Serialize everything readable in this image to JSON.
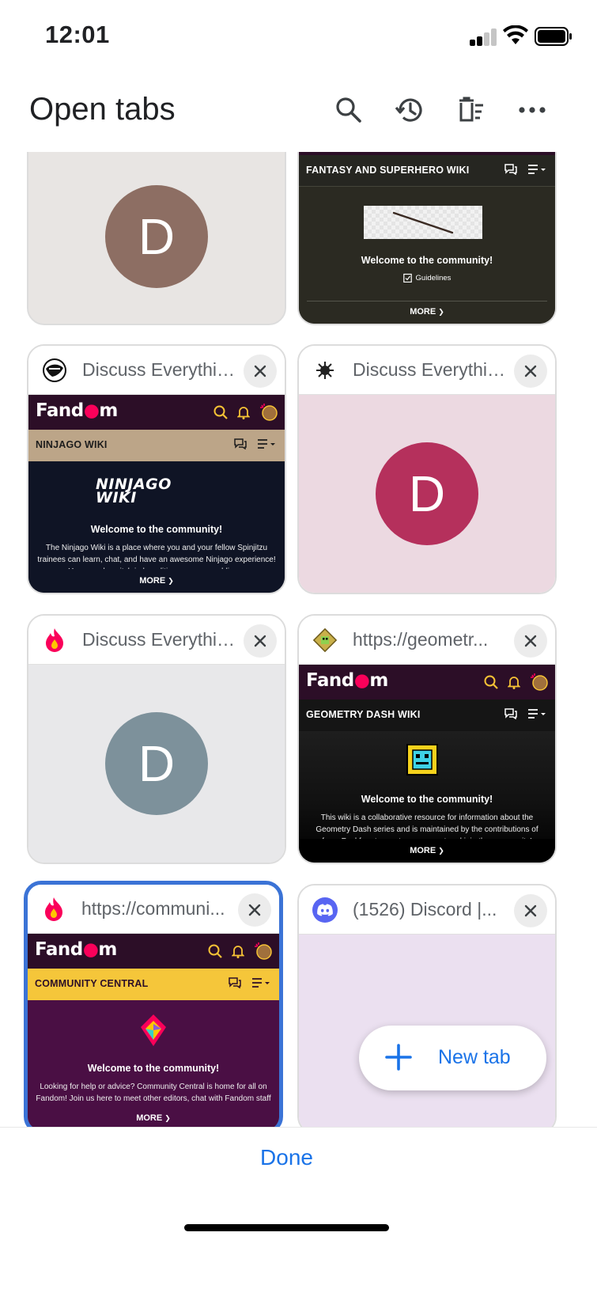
{
  "status_bar": {
    "time": "12:01"
  },
  "header": {
    "title": "Open tabs"
  },
  "tabs": [
    {
      "title": "",
      "wiki_name": "",
      "avatar_letter": "D"
    },
    {
      "title": "",
      "wiki_name": "FANTASY AND SUPERHERO WIKI",
      "welcome": "Welcome to the community!",
      "guidelines": "Guidelines",
      "more": "MORE"
    },
    {
      "title": "Discuss Everything...",
      "logo": "Fandom",
      "wiki_name": "NINJAGO WIKI",
      "wiki_logo": "NINJAGO WIKI",
      "welcome": "Welcome to the community!",
      "description": "The Ninjago Wiki is a place where you and your fellow Spinjitzu trainees can learn, chat, and have an awesome Ninjago experience! You can also pitch in by editing a page or adding a",
      "more": "MORE"
    },
    {
      "title": "Discuss Everything...",
      "avatar_letter": "D"
    },
    {
      "title": "Discuss Everything...",
      "avatar_letter": "D"
    },
    {
      "title": "https://geometr...",
      "logo": "Fandom",
      "wiki_name": "GEOMETRY DASH WIKI",
      "welcome": "Welcome to the community!",
      "description": "This wiki is a collaborative resource for information about the Geometry Dash series and is maintained by the contributions of fans. Feel free to create an account and join the community!",
      "more": "MORE"
    },
    {
      "title": "https://communi...",
      "logo": "Fandom",
      "wiki_name": "COMMUNITY CENTRAL",
      "welcome": "Welcome to the community!",
      "description": "Looking for help or advice? Community Central is home for all on Fandom! Join us here to meet other editors, chat with Fandom staff and learn tips & tricks for editing on your",
      "more": "MORE"
    },
    {
      "title": "(1526) Discord |..."
    }
  ],
  "new_tab": {
    "label": "New tab"
  },
  "footer": {
    "done_label": "Done"
  },
  "colors": {
    "accent": "#1a73e8",
    "selected_border": "#3b73d6",
    "fandom_bar": "#2c0e27",
    "avatar_brown": "#8d6e63",
    "avatar_red": "#b5305c",
    "avatar_slate": "#7d919b"
  }
}
